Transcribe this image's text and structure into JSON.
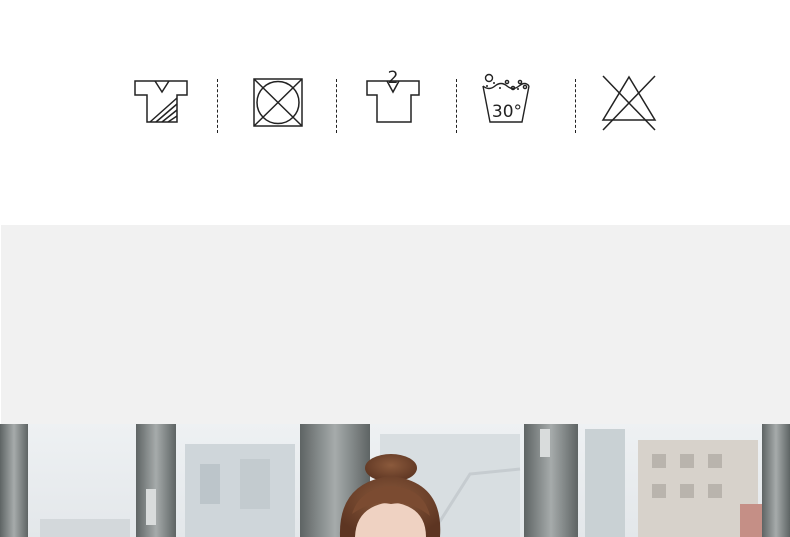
{
  "care_symbols": [
    {
      "id": "iron-symbol",
      "icon": "shirt-diagonal-lines-icon"
    },
    {
      "id": "no-tumble-dry",
      "icon": "crossed-square-circle-icon"
    },
    {
      "id": "hang-dry",
      "icon": "shirt-hanger-icon",
      "label": "2"
    },
    {
      "id": "wash-30",
      "icon": "wash-tub-icon",
      "label": "30°"
    },
    {
      "id": "no-bleach",
      "icon": "crossed-triangle-icon"
    }
  ],
  "photo": {
    "icon": "model-by-window-photo"
  },
  "colors": {
    "line": "#222222",
    "grey_band": "#f1f1f1",
    "window_frame": "#6d7272",
    "hair": "#7a4a30"
  }
}
